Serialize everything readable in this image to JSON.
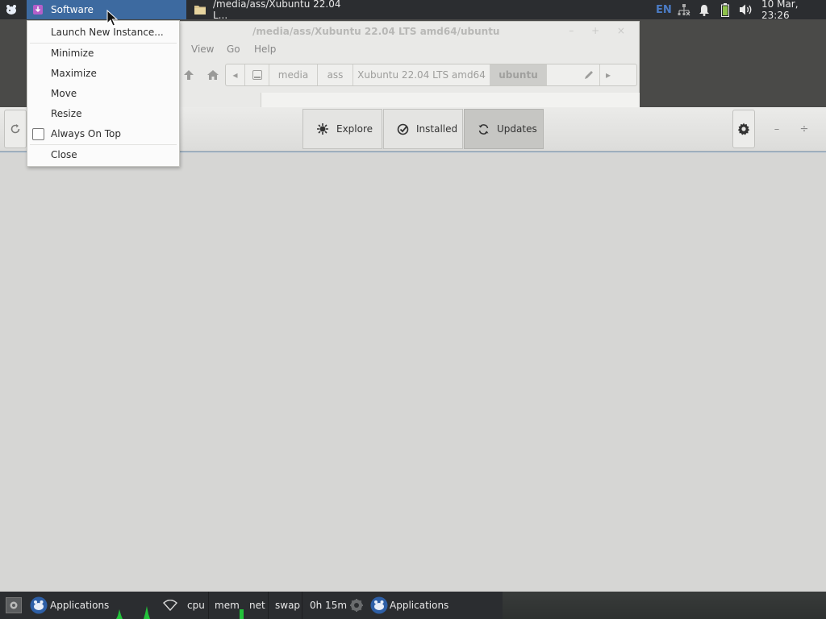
{
  "top_panel": {
    "tasks": [
      {
        "label": "Software",
        "icon": "software-center-icon",
        "active": true
      },
      {
        "label": "/media/ass/Xubuntu 22.04 L...",
        "icon": "folder-icon",
        "active": false
      }
    ],
    "tray": {
      "keyboard_layout": "EN",
      "clock": "10 Mar, 23:26"
    }
  },
  "context_menu": {
    "items": [
      {
        "label": "Launch New Instance..."
      },
      {
        "label": "Minimize"
      },
      {
        "label": "Maximize"
      },
      {
        "label": "Move"
      },
      {
        "label": "Resize"
      },
      {
        "label": "Always On Top",
        "checked": false
      },
      {
        "label": "Close"
      }
    ]
  },
  "file_manager": {
    "title": "/media/ass/Xubuntu 22.04 LTS amd64/ubuntu",
    "menu": [
      "View",
      "Go",
      "Help"
    ],
    "path": [
      "media",
      "ass",
      "Xubuntu 22.04 LTS amd64",
      "ubuntu"
    ]
  },
  "software": {
    "tabs": [
      {
        "label": "Explore",
        "icon": "explore-icon",
        "selected": false
      },
      {
        "label": "Installed",
        "icon": "installed-check-icon",
        "selected": false
      },
      {
        "label": "Updates",
        "icon": "updates-refresh-icon",
        "selected": true
      }
    ],
    "window_controls": {
      "minimize": "–",
      "maximize": "÷"
    }
  },
  "bottom_panel": {
    "applications_label": "Applications",
    "monitors": [
      "cpu",
      "mem",
      "net",
      "swap"
    ],
    "uptime": "0h 15m",
    "applications_label_2": "Applications"
  },
  "colors": {
    "panel_bg": "#2b2d30",
    "active_task": "#3d6aa0",
    "accent_blue": "#4b7bc4"
  }
}
